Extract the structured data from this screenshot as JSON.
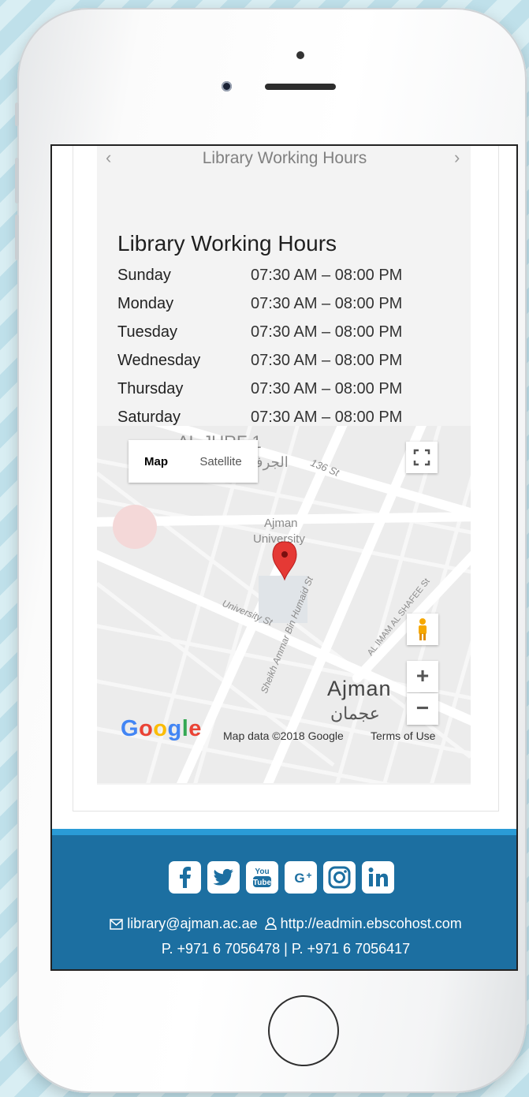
{
  "carousel": {
    "title": "Library Working Hours",
    "prev_icon": "chevron-left-icon",
    "next_icon": "chevron-right-icon"
  },
  "hours": {
    "heading": "Library Working Hours",
    "rows": [
      {
        "day": "Sunday",
        "time": "07:30 AM – 08:00 PM"
      },
      {
        "day": "Monday",
        "time": "07:30 AM – 08:00 PM"
      },
      {
        "day": "Tuesday",
        "time": "07:30 AM – 08:00 PM"
      },
      {
        "day": "Wednesday",
        "time": "07:30 AM – 08:00 PM"
      },
      {
        "day": "Thursday",
        "time": "07:30 AM – 08:00 PM"
      },
      {
        "day": "Saturday",
        "time": "07:30 AM – 08:00 PM"
      }
    ]
  },
  "map": {
    "type_buttons": {
      "map": "Map",
      "satellite": "Satellite"
    },
    "labels": {
      "district": "AL JURF 1",
      "district_ar": "الجرف",
      "street_136": "136 St",
      "university_line1": "Ajman",
      "university_line2": "University",
      "university_st": "University St",
      "sheikh_st": "Sheikh Ammar Bin Humaid St",
      "imam_st": "AL IMAM AL SHAFEE St",
      "city": "Ajman",
      "city_ar": "عجمان"
    },
    "zoom_in": "+",
    "zoom_out": "−",
    "logo": "Google",
    "attribution": "Map data ©2018 Google",
    "terms": "Terms of Use"
  },
  "footer": {
    "social": [
      {
        "icon": "facebook-icon",
        "glyph": "f"
      },
      {
        "icon": "twitter-icon",
        "glyph": "t"
      },
      {
        "icon": "youtube-icon",
        "glyph": "You Tube"
      },
      {
        "icon": "google-plus-icon",
        "glyph": "G+"
      },
      {
        "icon": "instagram-icon",
        "glyph": ""
      },
      {
        "icon": "linkedin-icon",
        "glyph": "in"
      }
    ],
    "email": "library@ajman.ac.ae",
    "website": "http://eadmin.ebscohost.com",
    "phones": "P. +971 6 7056478 | P. +971 6 7056417"
  },
  "colors": {
    "footer_bg": "#1c6fa1",
    "footer_strip": "#2a9bd6",
    "map_pin": "#e53935"
  }
}
